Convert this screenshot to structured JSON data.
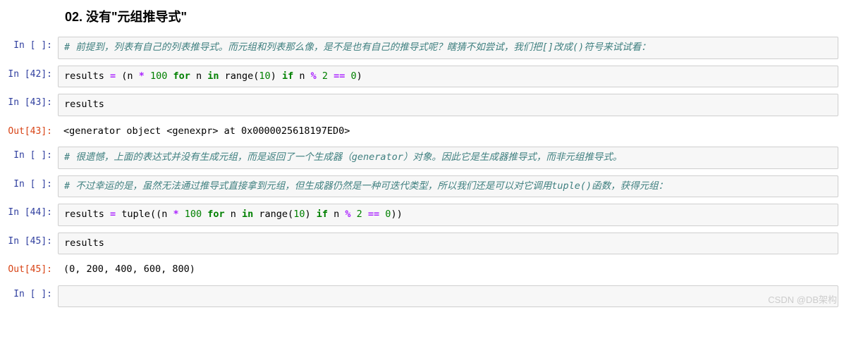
{
  "heading": "02. 没有\"元组推导式\"",
  "prompts": {
    "in_empty": "In [ ]:",
    "in42": "In [42]:",
    "in43": "In [43]:",
    "out43": "Out[43]:",
    "in44": "In [44]:",
    "in45": "In [45]:",
    "out45": "Out[45]:"
  },
  "code": {
    "comment1": "# 前提到，列表有自己的列表推导式。而元组和列表那么像，是不是也有自己的推导式呢？瞎猜不如尝试，我们把[]改成()符号来试试看：",
    "line42_var": "results ",
    "line42_eq": "=",
    "line42_open": " (n ",
    "line42_mul": "*",
    "line42_100": " 100",
    "line42_for": " for",
    "line42_n": " n ",
    "line42_in": "in",
    "line42_range": " range(",
    "line42_10": "10",
    "line42_close1": ") ",
    "line42_if": "if",
    "line42_n2": " n ",
    "line42_pct": "%",
    "line42_2": " 2",
    "line42_eqeq": " ==",
    "line42_0": " 0",
    "line42_close2": ")",
    "line43": "results",
    "out43": "<generator object <genexpr> at 0x0000025618197ED0>",
    "comment2": "# 很遗憾，上面的表达式并没有生成元组，而是返回了一个生成器（generator）对象。因此它是生成器推导式，而非元组推导式。",
    "comment3": "# 不过幸运的是，虽然无法通过推导式直接拿到元组，但生成器仍然是一种可迭代类型，所以我们还是可以对它调用tuple()函数，获得元组：",
    "line44_var": "results ",
    "line44_eq": "=",
    "line44_tuple": " tuple((n ",
    "line44_mul": "*",
    "line44_100": " 100",
    "line44_for": " for",
    "line44_n": " n ",
    "line44_in": "in",
    "line44_range": " range(",
    "line44_10": "10",
    "line44_close1": ") ",
    "line44_if": "if",
    "line44_n2": " n ",
    "line44_pct": "%",
    "line44_2": " 2",
    "line44_eqeq": " ==",
    "line44_0": " 0",
    "line44_close2": "))",
    "line45": "results",
    "out45": "(0, 200, 400, 600, 800)"
  },
  "watermark": "CSDN @DB架构",
  "chart_data": {
    "type": "table",
    "cells": [
      {
        "prompt": "In [ ]:",
        "kind": "input",
        "content": "# 前提到，列表有自己的列表推导式。而元组和列表那么像，是不是也有自己的推导式呢？瞎猜不如尝试，我们把[]改成()符号来试试看："
      },
      {
        "prompt": "In [42]:",
        "kind": "input",
        "content": "results = (n * 100 for n in range(10) if n % 2 == 0)"
      },
      {
        "prompt": "In [43]:",
        "kind": "input",
        "content": "results"
      },
      {
        "prompt": "Out[43]:",
        "kind": "output",
        "content": "<generator object <genexpr> at 0x0000025618197ED0>"
      },
      {
        "prompt": "In [ ]:",
        "kind": "input",
        "content": "# 很遗憾，上面的表达式并没有生成元组，而是返回了一个生成器（generator）对象。因此它是生成器推导式，而非元组推导式。"
      },
      {
        "prompt": "In [ ]:",
        "kind": "input",
        "content": "# 不过幸运的是，虽然无法通过推导式直接拿到元组，但生成器仍然是一种可迭代类型，所以我们还是可以对它调用tuple()函数，获得元组："
      },
      {
        "prompt": "In [44]:",
        "kind": "input",
        "content": "results = tuple((n * 100 for n in range(10) if n % 2 == 0))"
      },
      {
        "prompt": "In [45]:",
        "kind": "input",
        "content": "results"
      },
      {
        "prompt": "Out[45]:",
        "kind": "output",
        "content": "(0, 200, 400, 600, 800)"
      },
      {
        "prompt": "In [ ]:",
        "kind": "input",
        "content": ""
      }
    ]
  }
}
